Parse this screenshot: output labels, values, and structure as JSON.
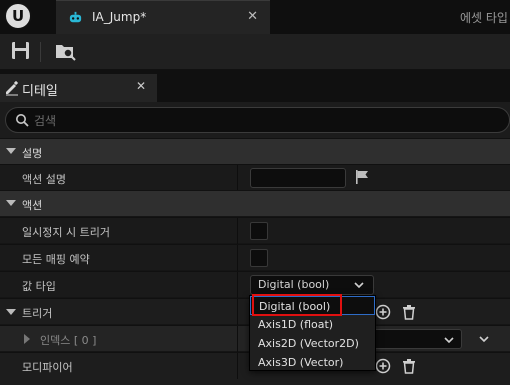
{
  "app": {
    "tab_title": "IA_Jump*",
    "tab_close": "✕",
    "right_tab_label": "에셋 타입"
  },
  "toolbar": {
    "save_icon": "save-icon",
    "browse_icon": "browse-asset-icon"
  },
  "details_panel": {
    "title": "디테일",
    "close": "✕",
    "search": {
      "placeholder": "검색",
      "value": ""
    }
  },
  "sections": {
    "description": {
      "title": "설명",
      "rows": {
        "action_description": {
          "label": "액션 설명",
          "value": ""
        }
      }
    },
    "action": {
      "title": "액션",
      "rows": {
        "trigger_when_paused": {
          "label": "일시정지 시 트리거",
          "checked": false
        },
        "reserve_all_mappings": {
          "label": "모든 매핑 예약",
          "checked": false
        },
        "value_type": {
          "label": "값 타입",
          "selected": "Digital (bool)"
        },
        "triggers": {
          "label": "트리거"
        },
        "index_0": {
          "label": "인덱스 [ 0 ]"
        },
        "modifiers": {
          "label": "모디파이어"
        }
      }
    }
  },
  "dropdown": {
    "options": [
      "Digital (bool)",
      "Axis1D (float)",
      "Axis2D (Vector2D)",
      "Axis3D (Vector)"
    ],
    "highlighted_index": 0
  },
  "colors": {
    "highlight_border": "#e01010",
    "selection_border": "#2e6cc7",
    "tab_icon": "#2ab8d6"
  }
}
